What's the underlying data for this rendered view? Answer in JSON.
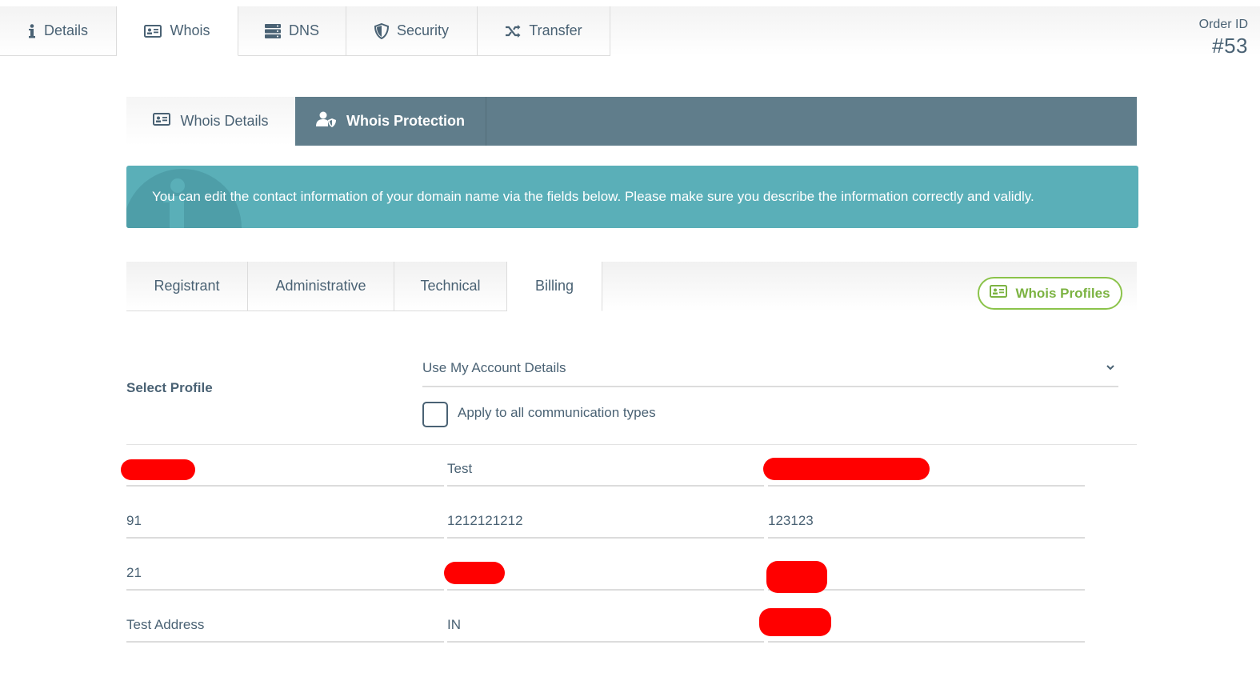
{
  "top_tabs": [
    {
      "label": "Details",
      "icon": "info-icon"
    },
    {
      "label": "Whois",
      "icon": "id-card-icon"
    },
    {
      "label": "DNS",
      "icon": "server-icon"
    },
    {
      "label": "Security",
      "icon": "shield-icon"
    },
    {
      "label": "Transfer",
      "icon": "shuffle-icon"
    }
  ],
  "active_top_tab": "Whois",
  "order": {
    "label": "Order ID",
    "number": "#53"
  },
  "whois_tabs": [
    {
      "label": "Whois Details",
      "icon": "id-card-icon"
    },
    {
      "label": "Whois Protection",
      "icon": "user-shield-icon"
    }
  ],
  "banner": {
    "message": "You can edit the contact information of your domain name via the fields below. Please make sure you describe the information correctly and validly."
  },
  "contact_tabs": [
    "Registrant",
    "Administrative",
    "Technical",
    "Billing"
  ],
  "active_contact_tab": "Billing",
  "whois_profiles_button": "Whois Profiles",
  "select_profile": {
    "label": "Select Profile",
    "value": "Use My Account Details"
  },
  "apply_all": {
    "label": "Apply to all communication types",
    "checked": false
  },
  "fields": {
    "row1": [
      "",
      "Test",
      ""
    ],
    "row2": [
      "91",
      "1212121212",
      "123123"
    ],
    "row3": [
      "21",
      "",
      ""
    ],
    "row4": [
      "Test Address",
      "IN",
      ""
    ]
  },
  "colors": {
    "text": "#4a6274",
    "subbar": "#607d8b",
    "banner": "#5aafb8",
    "accent_green": "#8bc34a",
    "redaction": "#ff0000"
  }
}
